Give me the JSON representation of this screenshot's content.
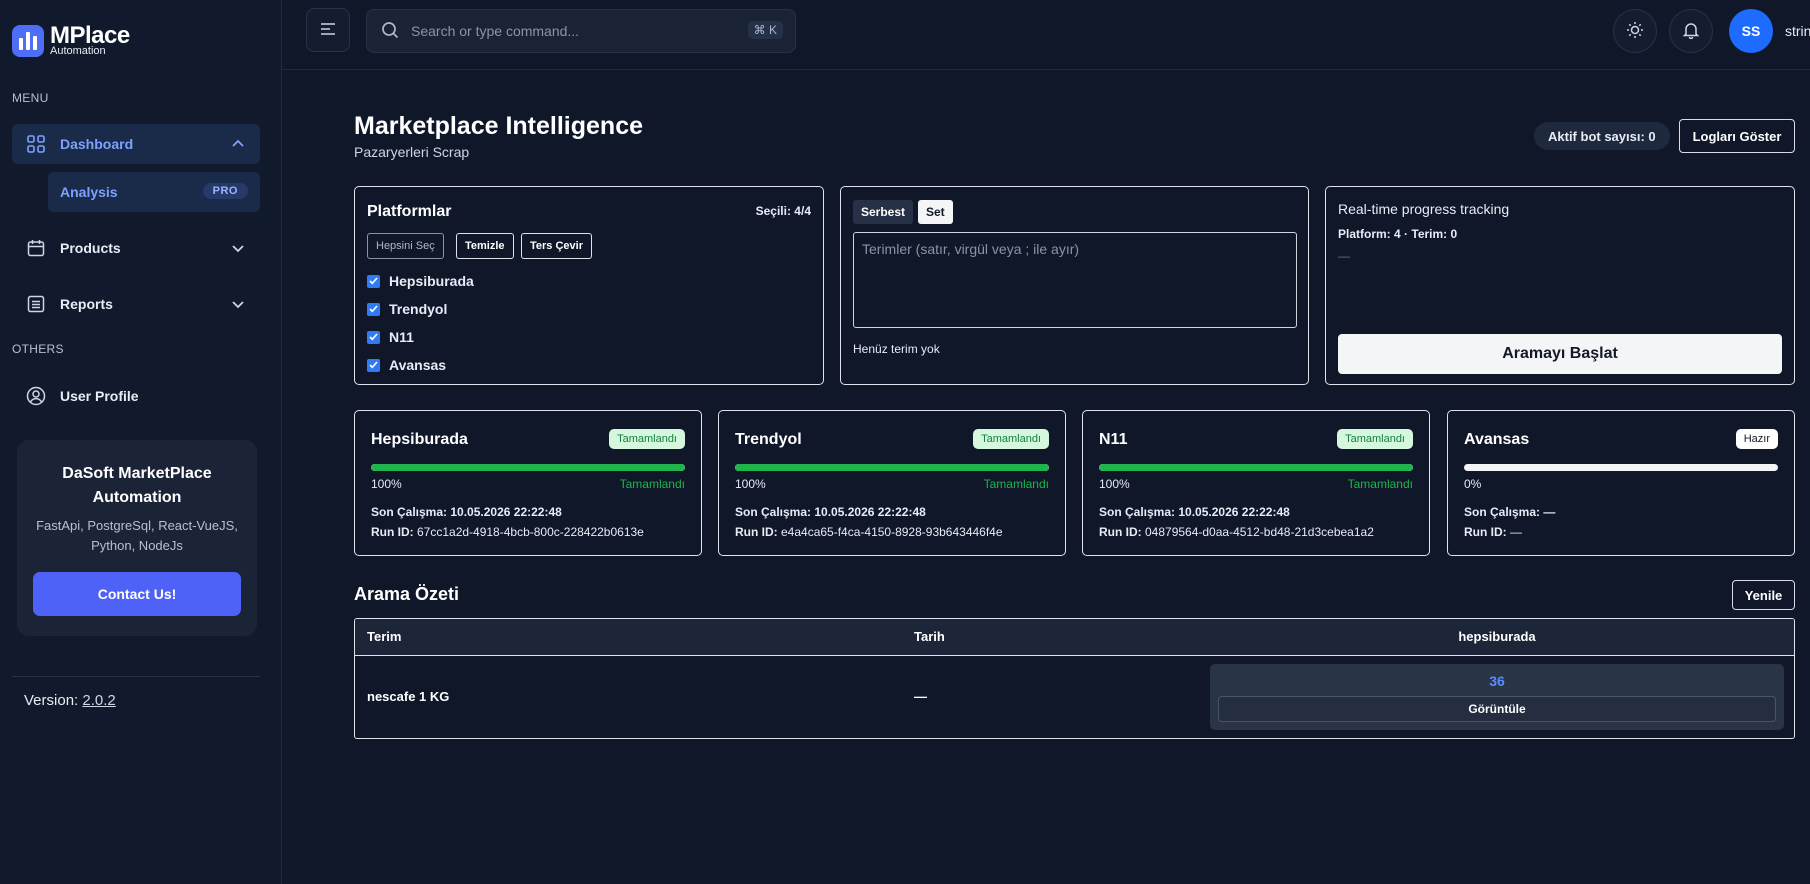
{
  "app": {
    "logo_title": "MPlace",
    "logo_subtitle": "Automation",
    "accent": "#4f6ef7"
  },
  "sidebar": {
    "menu_label": "MENU",
    "others_label": "OTHERS",
    "items": [
      {
        "label": "Dashboard",
        "icon": "grid-icon",
        "active": true,
        "expanded": true
      },
      {
        "label": "Products",
        "icon": "calendar-icon"
      },
      {
        "label": "Reports",
        "icon": "list-icon"
      }
    ],
    "sub_item": {
      "label": "Analysis",
      "badge": "PRO"
    },
    "user_profile": "User Profile",
    "promo": {
      "title": "DaSoft MarketPlace Automation",
      "desc": "FastApi, PostgreSql, React-VueJS, Python, NodeJs",
      "button": "Contact Us!"
    },
    "version_label": "Version:",
    "version_value": "2.0.2"
  },
  "header": {
    "search_placeholder": "Search or type command...",
    "shortcut": "⌘ K",
    "avatar_initials": "SS",
    "username": "strin"
  },
  "page": {
    "title": "Marketplace Intelligence",
    "subtitle": "Pazaryerleri Scrap",
    "active_bots": "Aktif bot sayısı: 0",
    "logs_button": "Logları Göster"
  },
  "platforms_panel": {
    "title": "Platformlar",
    "selected": "Seçili: 4/4",
    "buttons": {
      "select_all": "Hepsini Seç",
      "clear": "Temizle",
      "invert": "Ters Çevir"
    },
    "items": [
      {
        "label": "Hepsiburada",
        "checked": true
      },
      {
        "label": "Trendyol",
        "checked": true
      },
      {
        "label": "N11",
        "checked": true
      },
      {
        "label": "Avansas",
        "checked": true
      }
    ]
  },
  "terms_panel": {
    "tab_free": "Serbest",
    "tab_set": "Set",
    "placeholder": "Terimler (satır, virgül veya ; ile ayır)",
    "empty": "Henüz terim yok"
  },
  "progress_panel": {
    "title": "Real-time progress tracking",
    "platform_label": "Platform:",
    "platform_count": "4",
    "term_label": "· Terim:",
    "term_count": "0",
    "dash": "—",
    "start_button": "Aramayı Başlat"
  },
  "platform_cards": [
    {
      "name": "Hepsiburada",
      "badge": "Tamamlandı",
      "status": "done",
      "progress": 100,
      "pct": "100%",
      "pct_status": "Tamamlandı",
      "last_run_label": "Son Çalışma:",
      "last_run": "10.05.2026 22:22:48",
      "run_id_label": "Run ID:",
      "run_id": "67cc1a2d-4918-4bcb-800c-228422b0613e"
    },
    {
      "name": "Trendyol",
      "badge": "Tamamlandı",
      "status": "done",
      "progress": 100,
      "pct": "100%",
      "pct_status": "Tamamlandı",
      "last_run_label": "Son Çalışma:",
      "last_run": "10.05.2026 22:22:48",
      "run_id_label": "Run ID:",
      "run_id": "e4a4ca65-f4ca-4150-8928-93b643446f4e"
    },
    {
      "name": "N11",
      "badge": "Tamamlandı",
      "status": "done",
      "progress": 100,
      "pct": "100%",
      "pct_status": "Tamamlandı",
      "last_run_label": "Son Çalışma:",
      "last_run": "10.05.2026 22:22:48",
      "run_id_label": "Run ID:",
      "run_id": "04879564-d0aa-4512-bd48-21d3cebea1a2"
    },
    {
      "name": "Avansas",
      "badge": "Hazır",
      "status": "ready",
      "progress": 0,
      "pct": "0%",
      "pct_status": "",
      "last_run_label": "Son Çalışma:",
      "last_run": "—",
      "run_id_label": "Run ID:",
      "run_id": "—"
    }
  ],
  "summary": {
    "title": "Arama Özeti",
    "refresh": "Yenile",
    "columns": [
      "Terim",
      "Tarih",
      "hepsiburada"
    ],
    "rows": [
      {
        "term": "nescafe 1 KG",
        "date": "—",
        "count": "36",
        "view": "Görüntüle"
      }
    ]
  }
}
